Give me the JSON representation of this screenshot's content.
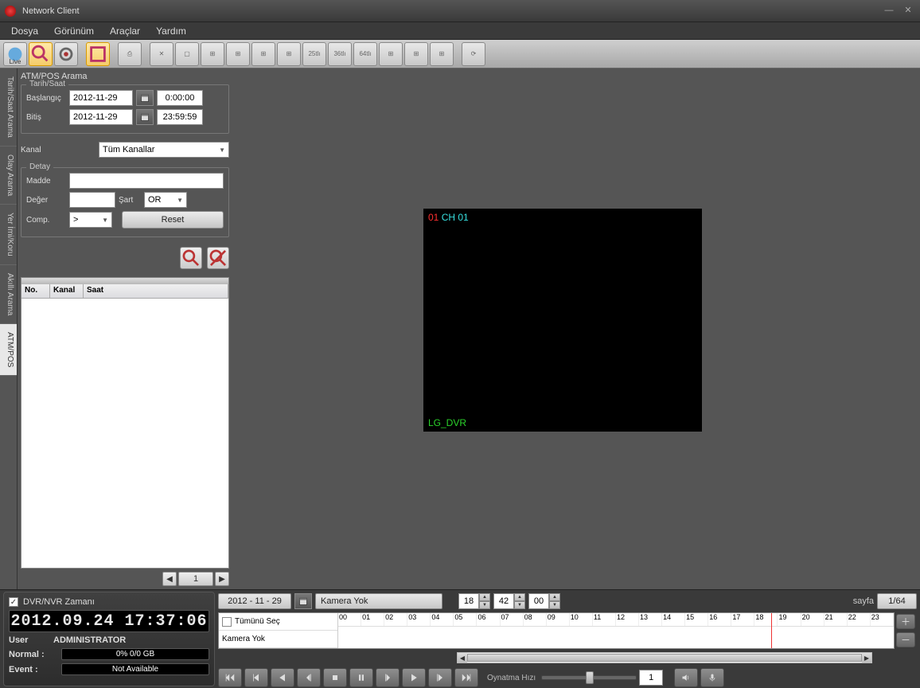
{
  "window": {
    "title": "Network Client"
  },
  "menus": [
    "Dosya",
    "Görünüm",
    "Araçlar",
    "Yardım"
  ],
  "sidetabs": [
    "Tarih/Saat Arama",
    "Olay Arama",
    "Yer İmi/Koru",
    "Akıllı Arama",
    "ATM/POS"
  ],
  "activeSideTab": 4,
  "panel": {
    "title": "ATM/POS Arama",
    "dategroup": "Tarih/Saat",
    "start_lbl": "Başlangıç",
    "end_lbl": "Bitiş",
    "start_date": "2012-11-29",
    "start_time": "0:00:00",
    "end_date": "2012-11-29",
    "end_time": "23:59:59",
    "channel_lbl": "Kanal",
    "channel_val": "Tüm Kanallar",
    "detail_group": "Detay",
    "item_lbl": "Madde",
    "item_val": "",
    "value_lbl": "Değer",
    "value_val": "",
    "cond_lbl": "Şart",
    "cond_val": "OR",
    "comp_lbl": "Comp.",
    "comp_val": ">",
    "reset": "Reset"
  },
  "results": {
    "cols": [
      "No.",
      "Kanal",
      "Saat"
    ],
    "page": "1"
  },
  "video": {
    "ch_idx": "01",
    "ch_name": "CH 01",
    "dvr": "LG_DVR"
  },
  "status": {
    "dvrtime_lbl": "DVR/NVR Zamanı",
    "clock": "2012.09.24 17:37:06",
    "user_lbl": "User",
    "user_val": "ADMINISTRATOR",
    "normal_lbl": "Normal :",
    "normal_val": "0% 0/0 GB",
    "event_lbl": "Event   :",
    "event_val": "Not Available"
  },
  "timeline": {
    "date": "2012 - 11 - 29",
    "cam": "Kamera Yok",
    "hh": "18",
    "mm": "42",
    "ss": "00",
    "page_lbl": "sayfa",
    "page_val": "1/64",
    "selectall": "Tümünü Seç",
    "row2": "Kamera Yok",
    "hours": [
      "00",
      "01",
      "02",
      "03",
      "04",
      "05",
      "06",
      "07",
      "08",
      "09",
      "10",
      "11",
      "12",
      "13",
      "14",
      "15",
      "16",
      "17",
      "18",
      "19",
      "20",
      "21",
      "22",
      "23"
    ]
  },
  "playback": {
    "speed_lbl": "Oynatma Hızı",
    "speed_val": "1"
  }
}
